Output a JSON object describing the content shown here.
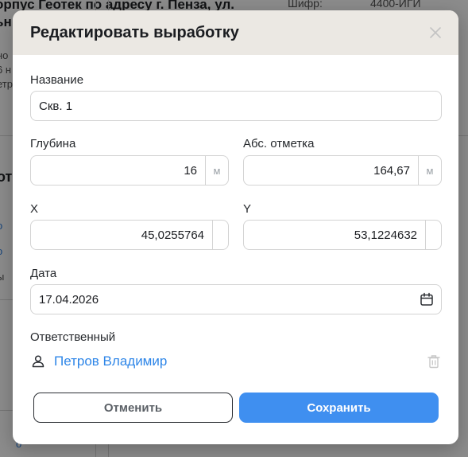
{
  "background": {
    "title_line1": "орпус Геотек по адресу г. Пенза, ул.",
    "title_line2": "ьн",
    "cipher_label": "Шифр:",
    "cipher_value": "4400-ИГИ",
    "frag1": "но",
    "frag2": "6 н",
    "frag3": "етр",
    "section_fragment": "от",
    "link1": "о",
    "link2": "о",
    "frag4": "ы",
    "link3": "о"
  },
  "modal": {
    "title": "Редактировать выработку",
    "close_icon": "close-icon",
    "name": {
      "label": "Название",
      "value": "Скв. 1"
    },
    "depth": {
      "label": "Глубина",
      "value": "16",
      "unit": "м"
    },
    "elevation": {
      "label": "Абс. отметка",
      "value": "164,67",
      "unit": "м"
    },
    "x": {
      "label": "X",
      "value": "45,0255764",
      "unit": ""
    },
    "y": {
      "label": "Y",
      "value": "53,1224632",
      "unit": ""
    },
    "date": {
      "label": "Дата",
      "value": "17.04.2026",
      "icon": "calendar-icon"
    },
    "responsible": {
      "label": "Ответственный",
      "person_icon": "person-icon",
      "name": "Петров Владимир",
      "delete_icon": "trash-icon"
    },
    "buttons": {
      "cancel": "Отменить",
      "save": "Сохранить"
    }
  },
  "colors": {
    "accent": "#3f8ff0",
    "link": "#2e86e8",
    "header_bg": "#ebe8e3"
  }
}
